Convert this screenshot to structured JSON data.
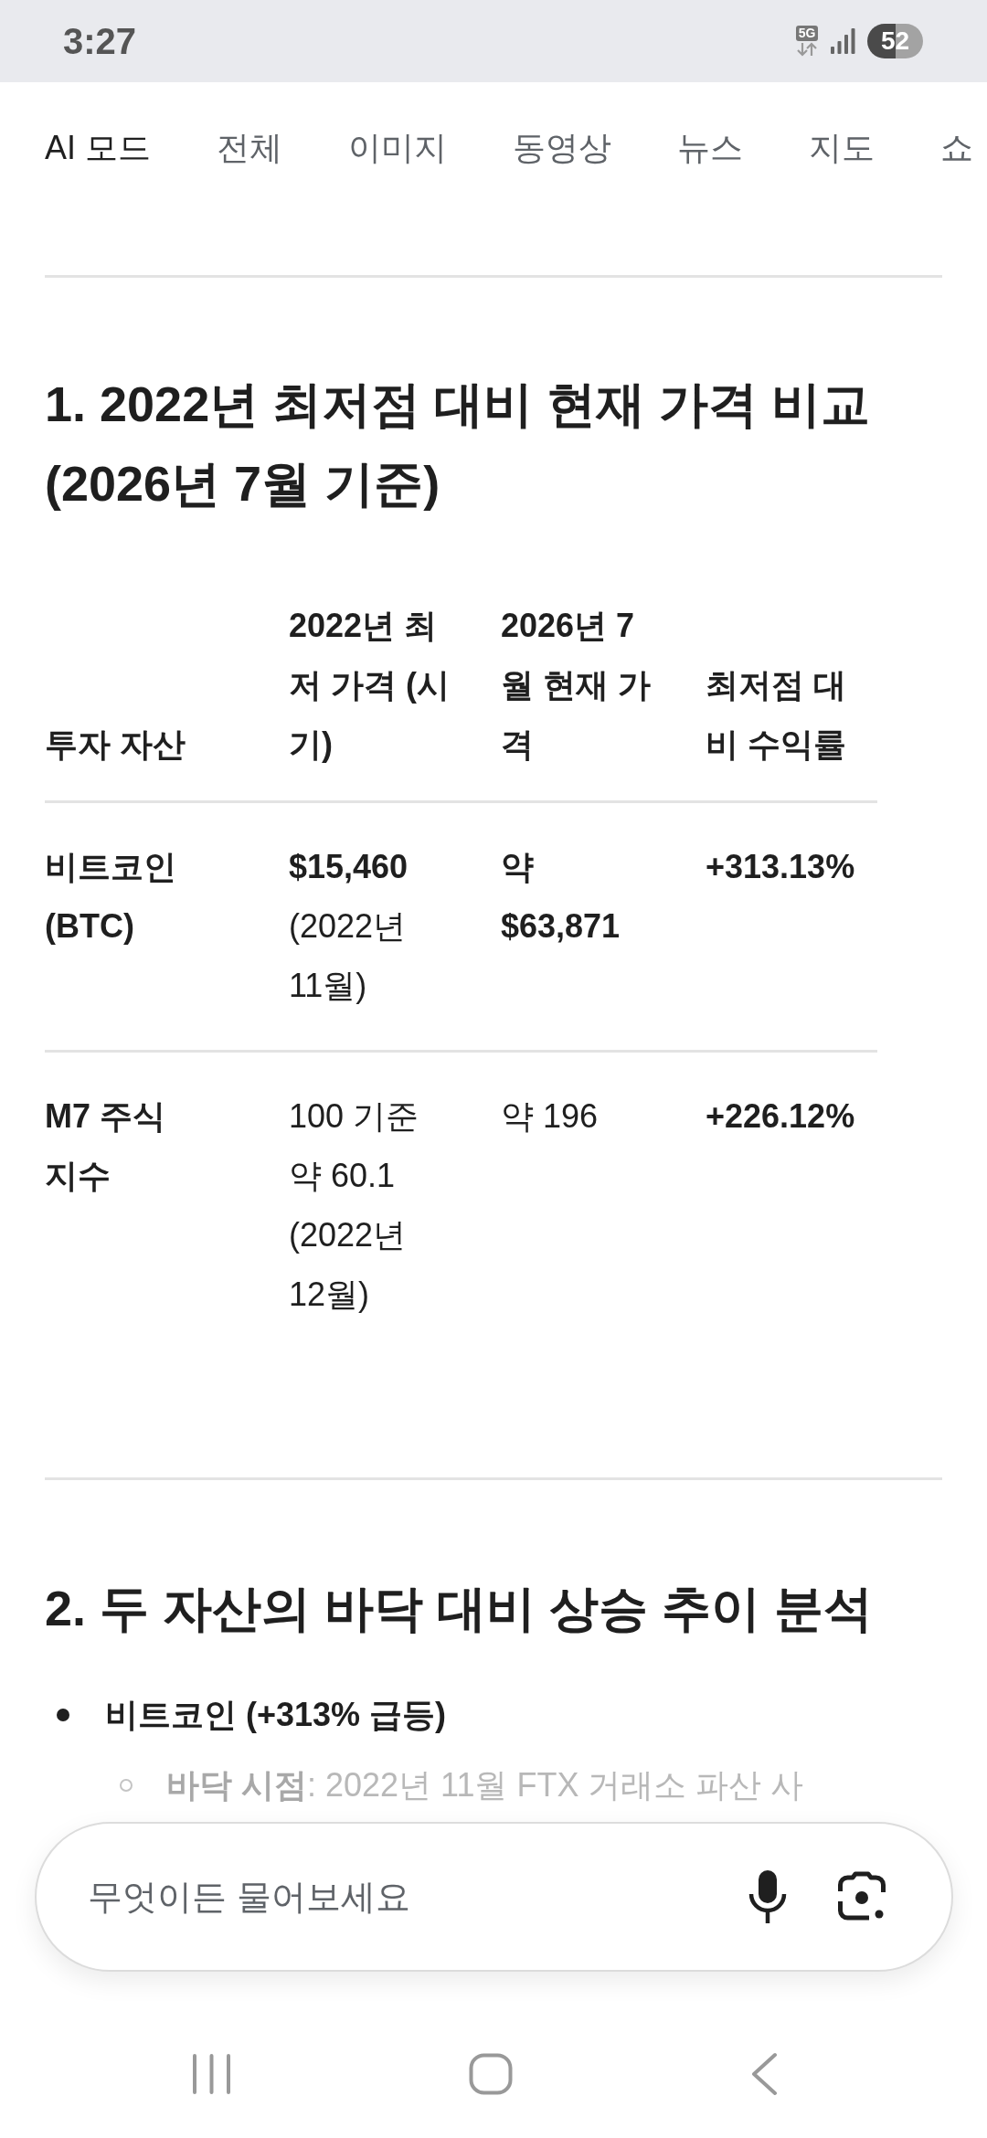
{
  "status_bar": {
    "time": "3:27",
    "network": "5G",
    "battery": "52"
  },
  "tabs": [
    {
      "label": "AI 모드",
      "selected": true
    },
    {
      "label": "전체",
      "selected": false
    },
    {
      "label": "이미지",
      "selected": false
    },
    {
      "label": "동영상",
      "selected": false
    },
    {
      "label": "뉴스",
      "selected": false
    },
    {
      "label": "지도",
      "selected": false
    },
    {
      "label": "쇼",
      "selected": false
    }
  ],
  "sections": [
    {
      "kind": "table",
      "heading": "1. 2022년 최저점 대비 현재 가격 비교 (2026년 7월 기준)",
      "table": {
        "columns": [
          "투자 자산",
          "2022년 최저 가격 (시기)",
          "2026년 7월 현재 가격",
          "최저점 대비 수익률"
        ],
        "rows": [
          {
            "cells": [
              {
                "text": "비트코인 (BTC)",
                "bold": true
              },
              {
                "text": "**$15,460** (2022년 11월)",
                "bold": false
              },
              {
                "text": "약 $63,871",
                "bold": true
              },
              {
                "text": "+313.13%",
                "bold": true
              }
            ]
          },
          {
            "cells": [
              {
                "text": "M7 주식 지수",
                "bold": true
              },
              {
                "text": "100 기준 약 60.1 (2022년 12월)",
                "bold": false
              },
              {
                "text": "약 196",
                "bold": false
              },
              {
                "text": "+226.12%",
                "bold": true
              }
            ]
          }
        ]
      }
    },
    {
      "kind": "list",
      "heading": "2. 두 자산의 바닥 대비 상승 추이 분석",
      "items": [
        {
          "text": "비트코인 (+313% 급등)",
          "children": [
            {
              "text": "**바닥 시점**: 2022년 11월 FTX 거래소 파산 사"
            }
          ]
        }
      ]
    }
  ],
  "search": {
    "placeholder": "무엇이든 물어보세요"
  }
}
